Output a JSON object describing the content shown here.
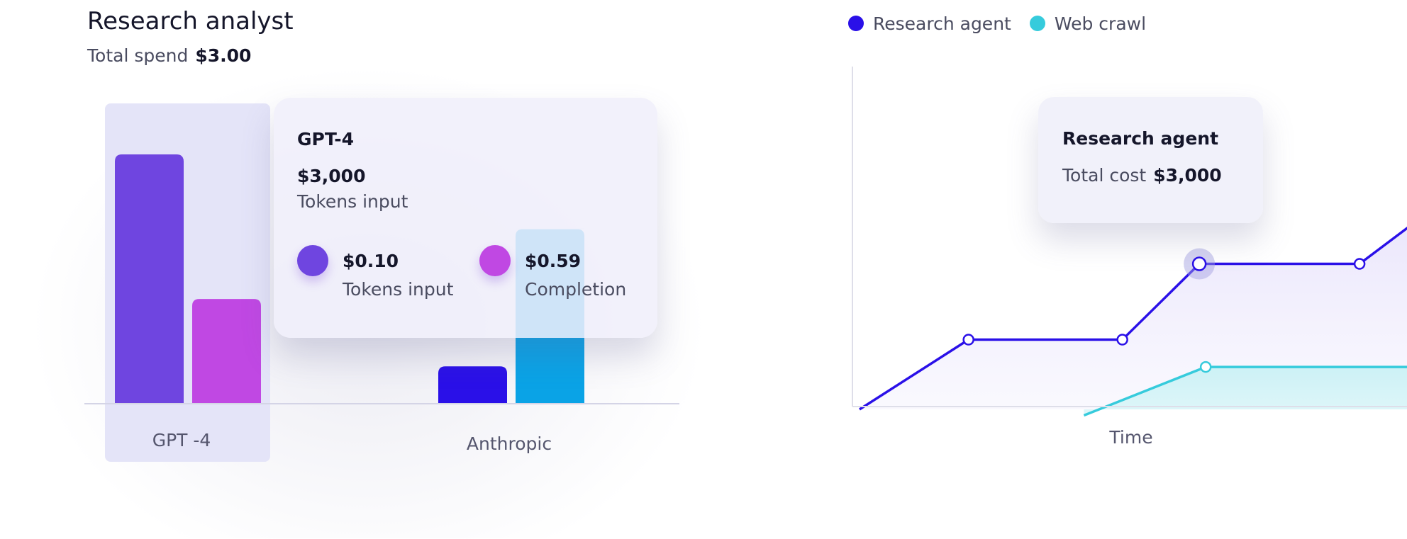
{
  "header": {
    "title": "Research analyst",
    "spend_label": "Total spend",
    "spend_value": "$3.00"
  },
  "bar_tooltip": {
    "title": "GPT-4",
    "amount": "$3,000",
    "amount_label": "Tokens input",
    "items": [
      {
        "value": "$0.10",
        "label": "Tokens input",
        "color": "#6f45e0"
      },
      {
        "value": "$0.59",
        "label": "Completion",
        "color": "#c048e3"
      }
    ]
  },
  "line_tooltip": {
    "title": "Research agent",
    "label": "Total cost",
    "value": "$3,000"
  },
  "chart_data": [
    {
      "type": "bar",
      "categories": [
        "GPT -4",
        "Anthropic"
      ],
      "series": [
        {
          "values": [
            100,
            15
          ],
          "colors": [
            "#6f45e0",
            "#2a10e8"
          ]
        },
        {
          "values": [
            42,
            70
          ],
          "colors": [
            "#c048e3",
            "#0aa3e6"
          ]
        }
      ],
      "highlighted_category": "GPT -4",
      "ylim": [
        0,
        100
      ],
      "grid": false
    },
    {
      "type": "area",
      "xlabel": "Time",
      "ylim": [
        0,
        100
      ],
      "legend": "top",
      "series": [
        {
          "name": "Research agent",
          "color": "#2a10e8",
          "points": [
            [
              0,
              0
            ],
            [
              17,
              23
            ],
            [
              41,
              23
            ],
            [
              53,
              48
            ],
            [
              78,
              48
            ],
            [
              100,
              83
            ]
          ],
          "markers": [
            1,
            2,
            3,
            4
          ],
          "highlighted": 3
        },
        {
          "name": "Web crawl",
          "color": "#36cbdc",
          "points": [
            [
              35,
              -2
            ],
            [
              54,
              14
            ],
            [
              100,
              14
            ]
          ],
          "markers": [
            1
          ]
        }
      ]
    }
  ]
}
